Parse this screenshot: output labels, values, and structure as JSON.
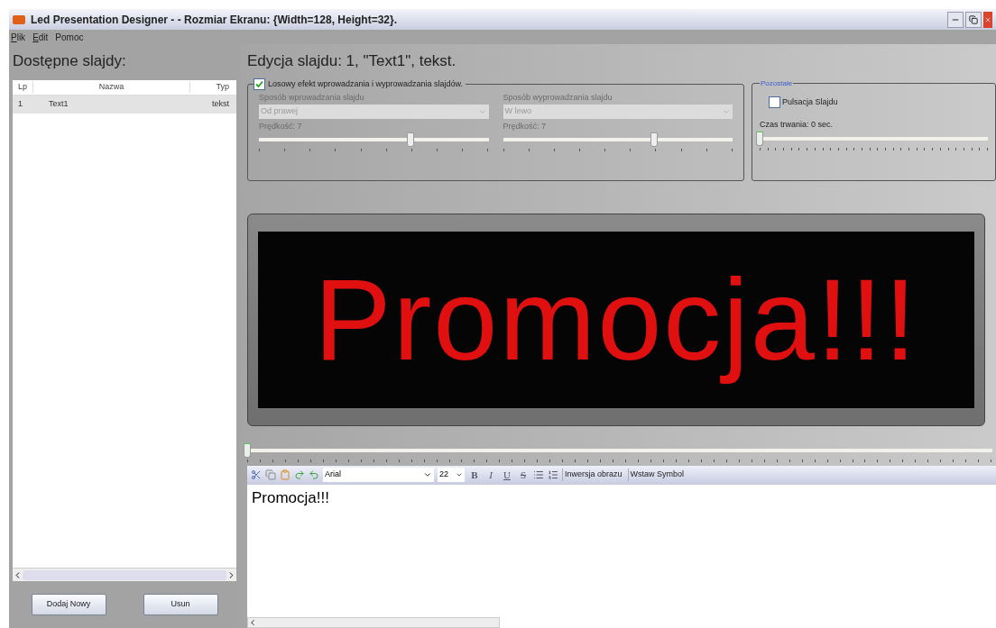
{
  "window": {
    "title": "Led Presentation Designer -  - Rozmiar Ekranu: {Width=128, Height=32}."
  },
  "menu": [
    {
      "accel": "P",
      "label_rest": "lik"
    },
    {
      "accel": "E",
      "label_rest": "dit"
    },
    {
      "label_rest": "Pomoc"
    }
  ],
  "slides_panel": {
    "title": "Dostępne slajdy:",
    "columns": [
      "Lp",
      "Nazwa",
      "Typ"
    ],
    "rows": [
      {
        "cells": [
          "1",
          "Text1",
          "tekst"
        ],
        "selected": true
      }
    ],
    "buttons": [
      "Dodaj Nowy",
      "Usun"
    ]
  },
  "editor": {
    "title": "Edycja slajdu: 1, \"Text1\", tekst.",
    "random_effect": {
      "label": "Losowy efekt wprowadzania i wyprowadzania slajdów.",
      "checked": true
    },
    "effects": [
      {
        "label": "Sposób wprowadzania slajdu",
        "value": "Od prawej",
        "speed_label": "Prędkość: 7",
        "level": 0.66,
        "disabled": true
      },
      {
        "label": "Sposób wyprowadzania slajdu",
        "value": "W lewo",
        "speed_label": "Prędkość: 7",
        "level": 0.66,
        "disabled": true
      }
    ],
    "other": {
      "title": "Pozostałe",
      "pulse": {
        "label": "Pulsacja Slajdu",
        "checked": false
      },
      "duration_label": "Czas trwania: 0 sec.",
      "level": 0
    },
    "preview": {
      "text": "Promocja!!!"
    },
    "timeline": {
      "level": 0
    },
    "toolbar": {
      "font": "Arial",
      "size": "22",
      "buttons": [
        {
          "kind": "bold",
          "label": "B"
        },
        {
          "kind": "italic",
          "label": "I"
        },
        {
          "kind": "underline",
          "label": "U"
        },
        {
          "kind": "strike",
          "label": "S"
        }
      ],
      "text_buttons": [
        "Inwersja obrazu",
        "Wstaw Symbol"
      ]
    },
    "content": "Promocja!!!"
  }
}
